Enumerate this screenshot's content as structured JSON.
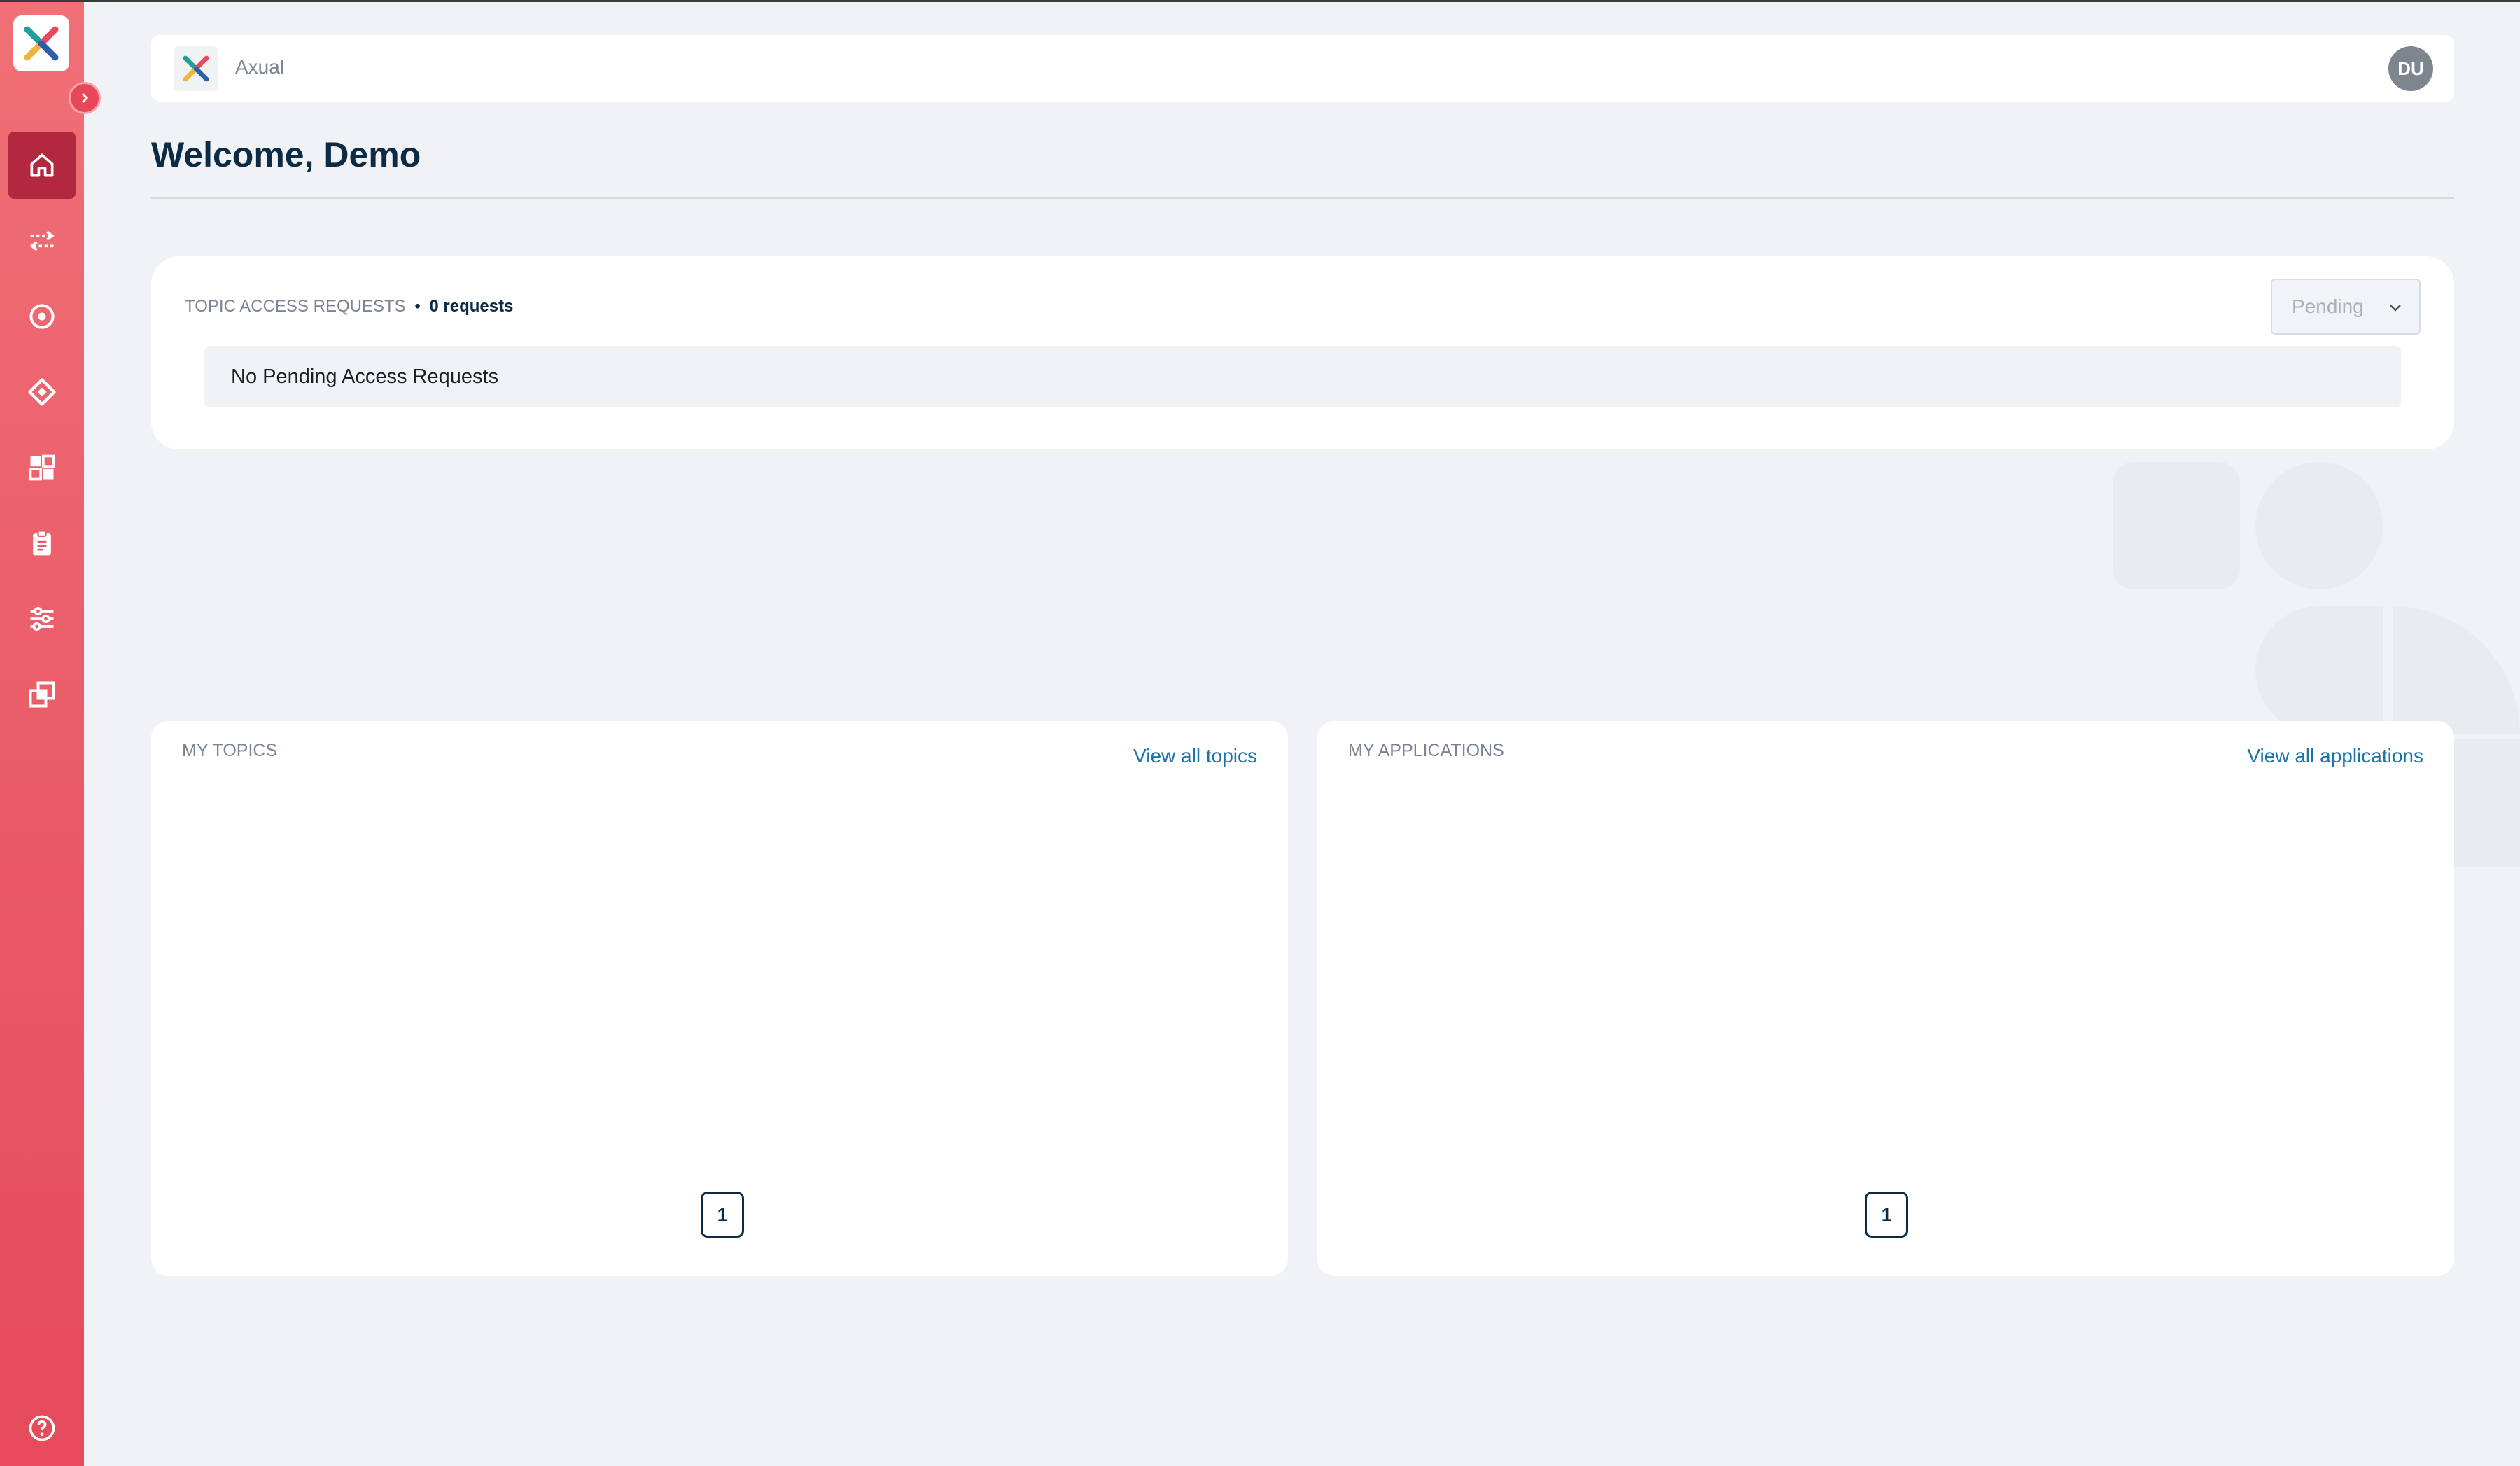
{
  "app": {
    "name": "Axual",
    "user_initials": "DU",
    "brand_color": "#ea5a67",
    "active_color": "#b2293f"
  },
  "sidebar": {
    "items": [
      {
        "icon": "home-icon",
        "active": true
      },
      {
        "icon": "streams-icon",
        "active": false
      },
      {
        "icon": "topics-icon",
        "active": false
      },
      {
        "icon": "applications-icon",
        "active": false
      },
      {
        "icon": "dashboard-icon",
        "active": false
      },
      {
        "icon": "clipboard-icon",
        "active": false
      },
      {
        "icon": "settings-sliders-icon",
        "active": false
      },
      {
        "icon": "environments-icon",
        "active": false
      }
    ],
    "footer_icon": "help-icon"
  },
  "page": {
    "welcome": "Welcome, Demo"
  },
  "access_requests": {
    "title": "TOPIC ACCESS REQUESTS",
    "separator": "•",
    "count": "0 requests",
    "filter_value": "Pending",
    "empty_message": "No Pending Access Requests"
  },
  "my_topics": {
    "title": "MY TOPICS",
    "link": "View all topics",
    "page": "1"
  },
  "my_applications": {
    "title": "MY APPLICATIONS",
    "link": "View all applications",
    "page": "1"
  }
}
